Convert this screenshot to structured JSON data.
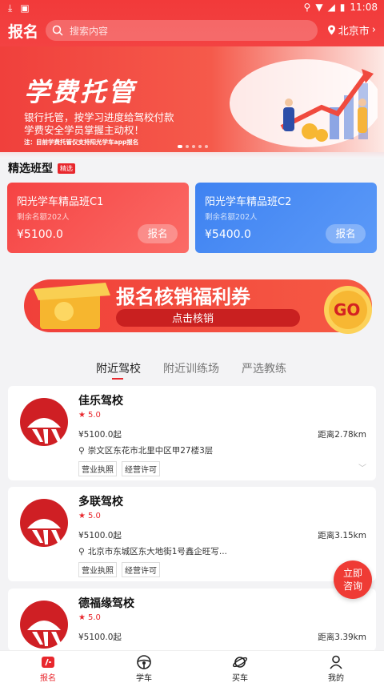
{
  "status": {
    "time": "11:08"
  },
  "header": {
    "title": "报名",
    "search_placeholder": "搜索内容",
    "city": "北京市"
  },
  "banner": {
    "title": "学费托管",
    "line1": "银行托管，按学习进度给驾校付款",
    "line2": "学费安全学员掌握主动权！",
    "note": "注：目前学费托管仅支持阳光学车app报名"
  },
  "section": {
    "title": "精选班型",
    "tag": "精选"
  },
  "classes": [
    {
      "name": "阳光学车精品班C1",
      "remain": "剩余名额202人",
      "price": "¥5100.0",
      "button": "报名",
      "color": "#f54343"
    },
    {
      "name": "阳光学车精品班C2",
      "remain": "剩余名额202人",
      "price": "¥5400.0",
      "button": "报名",
      "color": "#3e82f1"
    }
  ],
  "coupon": {
    "title": "报名核销福利券",
    "subtitle": "点击核销",
    "go": "GO"
  },
  "tabs": [
    "附近驾校",
    "附近训练场",
    "严选教练"
  ],
  "schools": [
    {
      "name": "佳乐驾校",
      "rating": "5.0",
      "price": "¥5100.0起",
      "distance": "距离2.78km",
      "address": "崇文区东花市北里中区甲27楼3层",
      "tags": [
        "营业执照",
        "经营许可"
      ]
    },
    {
      "name": "多联驾校",
      "rating": "5.0",
      "price": "¥5100.0起",
      "distance": "距离3.15km",
      "address": "北京市东城区东大地街1号鑫企旺写...",
      "tags": [
        "营业执照",
        "经营许可"
      ]
    },
    {
      "name": "德福缘驾校",
      "rating": "5.0",
      "price": "¥5100.0起",
      "distance": "距离3.39km",
      "address": "",
      "tags": []
    }
  ],
  "float_button": {
    "line1": "立即",
    "line2": "咨询"
  },
  "nav": [
    {
      "label": "报名",
      "icon": "signup-icon",
      "active": true
    },
    {
      "label": "学车",
      "icon": "steering-wheel-icon",
      "active": false
    },
    {
      "label": "买车",
      "icon": "planet-icon",
      "active": false
    },
    {
      "label": "我的",
      "icon": "person-icon",
      "active": false
    }
  ],
  "colors": {
    "brand_red": "#e8272d",
    "blue": "#3e82f1"
  }
}
